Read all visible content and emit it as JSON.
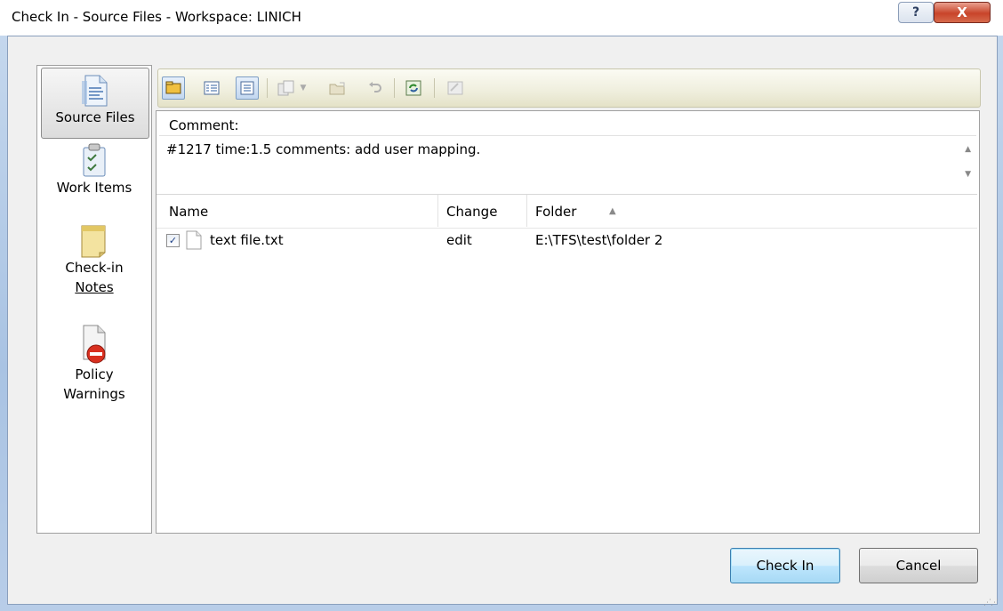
{
  "window": {
    "title": "Check In - Source Files - Workspace: LINICH",
    "help_label": "?",
    "close_label": "X"
  },
  "sidebar": {
    "items": [
      {
        "label": "Source Files",
        "icon": "source-files-icon",
        "selected": true
      },
      {
        "label": "Work Items",
        "icon": "work-items-icon",
        "selected": false
      },
      {
        "label_line1": "Check-in",
        "label_line2": "Notes",
        "icon": "check-in-notes-icon",
        "selected": false
      },
      {
        "label_line1": "Policy",
        "label_line2": "Warnings",
        "icon": "policy-warnings-icon",
        "selected": false
      }
    ]
  },
  "toolbar": {
    "buttons": [
      {
        "name": "folder-view-icon",
        "pressed": true
      },
      {
        "name": "details-view-icon",
        "pressed": false
      },
      {
        "name": "list-view-icon",
        "pressed": true
      },
      {
        "name": "compare-icon",
        "pressed": false
      },
      {
        "name": "dropdown-arrow-icon",
        "pressed": false
      },
      {
        "name": "open-icon",
        "pressed": false
      },
      {
        "name": "undo-icon",
        "pressed": false
      },
      {
        "name": "refresh-icon",
        "pressed": false
      },
      {
        "name": "shelve-icon",
        "pressed": false
      }
    ]
  },
  "comment": {
    "label": "Comment:",
    "text": "#1217 time:1.5 comments: add user mapping."
  },
  "grid": {
    "columns": [
      "Name",
      "Change",
      "Folder"
    ],
    "sort_column": "Folder",
    "rows": [
      {
        "checked": true,
        "name": "text file.txt",
        "change": "edit",
        "folder": "E:\\TFS\\test\\folder 2"
      }
    ]
  },
  "buttons": {
    "check_in": "Check In",
    "cancel": "Cancel"
  },
  "colors": {
    "title_bg": "#ffffff",
    "frame": "#b8cde8",
    "toolbar": "#efeedd",
    "default_button": "#bee6fd",
    "close_button": "#c8442a"
  }
}
